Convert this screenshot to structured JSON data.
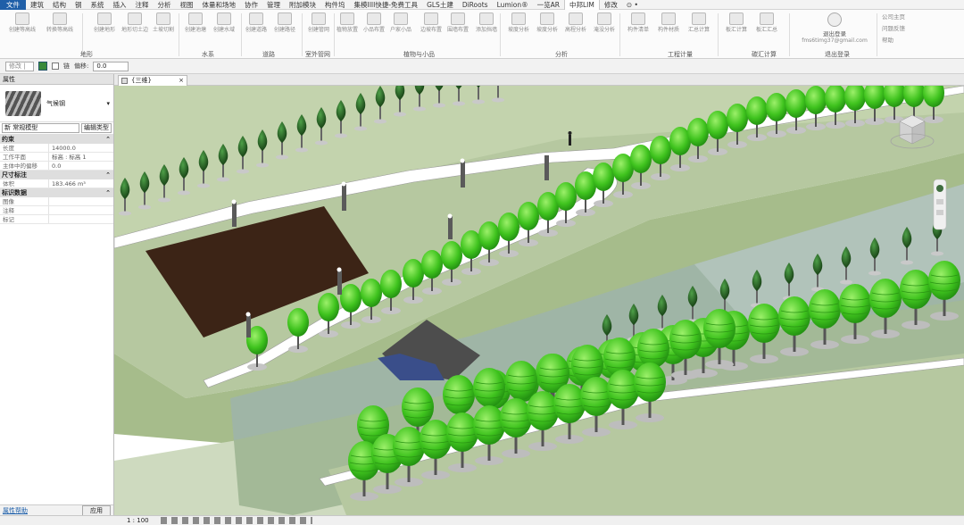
{
  "menu": [
    {
      "label": "文件",
      "kind": "file"
    },
    {
      "label": "建筑"
    },
    {
      "label": "结构"
    },
    {
      "label": "钢"
    },
    {
      "label": "系统"
    },
    {
      "label": "插入"
    },
    {
      "label": "注释"
    },
    {
      "label": "分析"
    },
    {
      "label": "视图"
    },
    {
      "label": "体量和场地"
    },
    {
      "label": "协作"
    },
    {
      "label": "管理"
    },
    {
      "label": "附加模块"
    },
    {
      "label": "构件坞"
    },
    {
      "label": "集模IIII快捷-免费工具"
    },
    {
      "label": "GLS土建"
    },
    {
      "label": "DiRoots"
    },
    {
      "label": "Lumion®"
    },
    {
      "label": "一览AR"
    },
    {
      "label": "中邦LIM",
      "kind": "active"
    },
    {
      "label": "修改"
    },
    {
      "label": "⊙ •"
    }
  ],
  "ribbon": {
    "buttons": [
      {
        "label": "创建等高线"
      },
      {
        "label": "转换等高线"
      },
      {
        "label": "创建地形"
      },
      {
        "label": "地形切土边"
      },
      {
        "label": "土坡切割"
      },
      {
        "label": "创建池塘"
      },
      {
        "label": "创建水域"
      },
      {
        "label": "创建道路"
      },
      {
        "label": "创建路径"
      },
      {
        "label": "创建管网"
      },
      {
        "label": "植物放置"
      },
      {
        "label": "小品布置"
      },
      {
        "label": "户家小品"
      },
      {
        "label": "边坡布置"
      },
      {
        "label": "围墙布置"
      },
      {
        "label": "添加挡墙"
      },
      {
        "label": "坡度分析"
      },
      {
        "label": "坡度分析"
      },
      {
        "label": "高程分析"
      },
      {
        "label": "淹没分析"
      },
      {
        "label": "构件清单"
      },
      {
        "label": "构件材质"
      },
      {
        "label": "汇总计算"
      },
      {
        "label": "板汇计算"
      },
      {
        "label": "板汇汇总"
      }
    ],
    "groups": [
      "地形",
      "水系",
      "道路",
      "室外管网",
      "植物与小品",
      "分析",
      "工程计量",
      "碳汇计算",
      "退出登录"
    ],
    "user": {
      "label": "退出登录",
      "email": "fms6timg37@gmail.com"
    },
    "right_items": [
      "公司主页",
      "问题反馈",
      "帮助"
    ]
  },
  "options_bar": {
    "modify": "修改 | ...",
    "chain_label": "链",
    "offset_label": "偏移:",
    "offset_value": "0.0"
  },
  "properties": {
    "title": "属性",
    "type_name": "气候钢",
    "type_selector": "新 常规模型",
    "edit_type": "编辑类型",
    "categories": [
      {
        "name": "约束",
        "rows": [
          {
            "key": "长度",
            "value": "14000.0"
          },
          {
            "key": "工作平面",
            "value": "标高 : 标高 1"
          },
          {
            "key": "主体中的偏移",
            "value": "0.0"
          }
        ]
      },
      {
        "name": "尺寸标注",
        "rows": [
          {
            "key": "体积",
            "value": "183.466 m³"
          }
        ]
      },
      {
        "name": "标识数据",
        "rows": [
          {
            "key": "图像",
            "value": ""
          },
          {
            "key": "注释",
            "value": ""
          },
          {
            "key": "标记",
            "value": ""
          }
        ]
      }
    ],
    "help_link": "属性帮助",
    "apply_button": "应用"
  },
  "view": {
    "tab_label": "{三维}"
  },
  "status": {
    "scale": "1 : 100"
  }
}
